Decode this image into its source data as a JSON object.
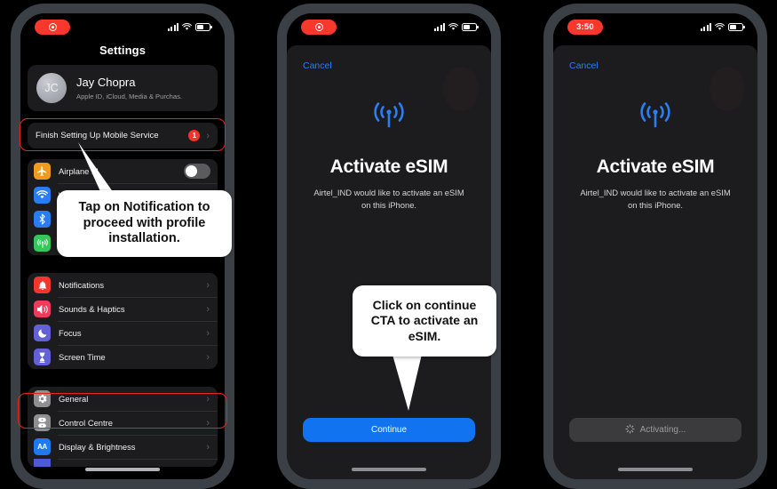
{
  "meta": {
    "title": "eSIM activation walkthrough — three iPhone screens",
    "accent_blue": "#1273f0",
    "highlight_red": "#e8251c",
    "badge_red": "#f2352b",
    "sheet_bg": "#1c1c1e"
  },
  "phone1": {
    "status": {
      "pill_label": "",
      "pill_icon": "record-icon",
      "signal": "cellular-bars-icon",
      "wifi": "wifi-icon",
      "battery": "battery-icon"
    },
    "nav_title": "Settings",
    "profile": {
      "initials": "JC",
      "name": "Jay Chopra",
      "subtitle": "Apple ID, iCloud, Media & Purchas."
    },
    "notification_row": {
      "label": "Finish Setting Up Mobile Service",
      "badge": "1",
      "chevron": "›"
    },
    "group_connectivity": [
      {
        "label": "Airplane M",
        "icon": "airplane-icon",
        "color": "#f09a20",
        "control": "toggle",
        "toggle_on": false
      },
      {
        "label": "Wi-Fi",
        "icon": "wifi-icon",
        "color": "#2a7df0",
        "control": "chevron"
      },
      {
        "label": "Bluetooth",
        "icon": "bluetooth-icon",
        "color": "#2a7df0",
        "control": "chevron"
      },
      {
        "label": "Mobile Service",
        "icon": "cellular-icon",
        "color": "#34c75a",
        "control": "chevron"
      }
    ],
    "group_alerts": [
      {
        "label": "Notifications",
        "icon": "bell-icon",
        "color": "#f2362e",
        "control": "chevron"
      },
      {
        "label": "Sounds & Haptics",
        "icon": "speaker-icon",
        "color": "#f03a5c",
        "control": "chevron"
      },
      {
        "label": "Focus",
        "icon": "moon-icon",
        "color": "#6361d8",
        "control": "chevron"
      },
      {
        "label": "Screen Time",
        "icon": "hourglass-icon",
        "color": "#6361d8",
        "control": "chevron"
      }
    ],
    "group_system": [
      {
        "label": "General",
        "icon": "gear-icon",
        "color": "#8e8e93",
        "control": "chevron"
      },
      {
        "label": "Control Centre",
        "icon": "control-centre-icon",
        "color": "#8e8e93",
        "control": "chevron"
      },
      {
        "label": "Display & Brightness",
        "icon": "aa-icon",
        "color": "#1f7af0",
        "control": "chevron"
      }
    ]
  },
  "phone2": {
    "status": {
      "pill_label": "",
      "pill_icon": "record-icon"
    },
    "cancel_label": "Cancel",
    "hero_icon": "esim-antenna-icon",
    "title": "Activate eSIM",
    "description": "Airtel_IND would like to activate an eSIM on this iPhone.",
    "cta_label": "Continue"
  },
  "phone3": {
    "status": {
      "pill_label": "3:50",
      "pill_icon": "time-label"
    },
    "cancel_label": "Cancel",
    "hero_icon": "esim-antenna-icon",
    "title": "Activate eSIM",
    "description": "Airtel_IND would like to activate an eSIM on this iPhone.",
    "cta_label": "Activating...",
    "cta_spinner": "spinner-icon"
  },
  "callouts": [
    {
      "text": "Tap on Notification to proceed with profile installation."
    },
    {
      "text": "Click on continue CTA to activate an eSIM."
    }
  ]
}
